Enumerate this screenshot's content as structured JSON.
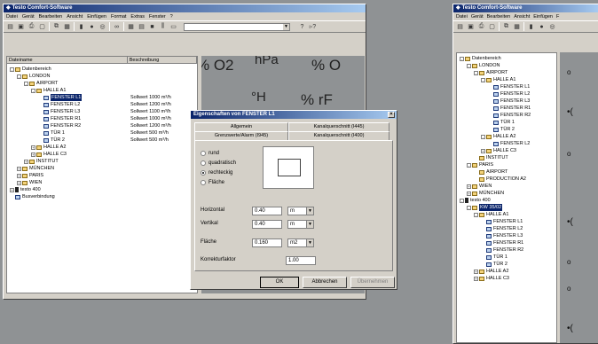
{
  "left_window": {
    "title": "Testo Comfort-Software",
    "menu": [
      "Datei",
      "Gerät",
      "Bearbeiten",
      "Ansicht",
      "Einfügen",
      "Format",
      "Extras",
      "Fenster",
      "?"
    ],
    "columns": [
      "Dateiname",
      "Beschreibung"
    ],
    "tree": [
      {
        "label": "Datenbereich",
        "level": 0,
        "icon": "folder",
        "exp": "-"
      },
      {
        "label": "LONDON",
        "level": 1,
        "icon": "folder",
        "exp": "-"
      },
      {
        "label": "AIRPORT",
        "level": 2,
        "icon": "folder",
        "exp": "-"
      },
      {
        "label": "HALLE A1",
        "level": 3,
        "icon": "folder",
        "exp": "-"
      },
      {
        "label": "FENSTER L1",
        "level": 4,
        "icon": "window",
        "desc": "Sollwert 1000 m³/h",
        "selected": true
      },
      {
        "label": "FENSTER L2",
        "level": 4,
        "icon": "window",
        "desc": "Sollwert 1200 m³/h"
      },
      {
        "label": "FENSTER L3",
        "level": 4,
        "icon": "window",
        "desc": "Sollwert 1100 m³/h"
      },
      {
        "label": "FENSTER R1",
        "level": 4,
        "icon": "window",
        "desc": "Sollwert 1000 m³/h"
      },
      {
        "label": "FENSTER R2",
        "level": 4,
        "icon": "window",
        "desc": "Sollwert 1200 m³/h"
      },
      {
        "label": "TÜR 1",
        "level": 4,
        "icon": "window",
        "desc": "Sollwert 500 m³/h"
      },
      {
        "label": "TÜR 2",
        "level": 4,
        "icon": "window",
        "desc": "Sollwert 500 m³/h"
      },
      {
        "label": "HALLE A2",
        "level": 3,
        "icon": "folder",
        "exp": "+"
      },
      {
        "label": "HALLE C3",
        "level": 3,
        "icon": "folder",
        "exp": "+"
      },
      {
        "label": "INSTITUT",
        "level": 2,
        "icon": "folder",
        "exp": "+"
      },
      {
        "label": "MÜNCHEN",
        "level": 1,
        "icon": "folder",
        "exp": "+"
      },
      {
        "label": "PARIS",
        "level": 1,
        "icon": "folder",
        "exp": "+"
      },
      {
        "label": "WIEN",
        "level": 1,
        "icon": "folder",
        "exp": "+"
      },
      {
        "label": "testo 400",
        "level": 0,
        "icon": "device",
        "exp": "+"
      },
      {
        "label": "Busverbindung",
        "level": 0,
        "icon": "bus"
      }
    ],
    "units": [
      "% O2",
      "hPa",
      "% O",
      "°H",
      "% rF"
    ]
  },
  "dialog": {
    "title": "Eigenschaften von FENSTER L1",
    "tabs_back": [
      "Allgemein",
      "Kanalquerschnitt (I445)"
    ],
    "tabs_front": [
      "Grenzwerte/Alarm (I945)",
      "Kanalquerschnitt (I400)"
    ],
    "shapes": [
      "rund",
      "quadratisch",
      "rechteckig",
      "Fläche"
    ],
    "selected_shape": "rechteckig",
    "horizontal_label": "Horizontal",
    "horizontal_value": "0.40",
    "horizontal_unit": "m",
    "vertical_label": "Vertikal",
    "vertical_value": "0.40",
    "vertical_unit": "m",
    "area_label": "Fläche",
    "area_value": "0.160",
    "area_unit": "m2",
    "factor_label": "Korrekturfaktor",
    "factor_value": "1.00",
    "ok": "OK",
    "cancel": "Abbrechen",
    "apply": "Übernehmen"
  },
  "right_window": {
    "title": "Testo Comfort-Software",
    "menu": [
      "Datei",
      "Gerät",
      "Bearbeiten",
      "Ansicht",
      "Einfügen",
      "F"
    ],
    "tree": [
      {
        "label": "Datenbereich",
        "level": 0,
        "icon": "folder",
        "exp": "-"
      },
      {
        "label": "LONDON",
        "level": 1,
        "icon": "folder",
        "exp": "-"
      },
      {
        "label": "AIRPORT",
        "level": 2,
        "icon": "folder",
        "exp": "-"
      },
      {
        "label": "HALLE A1",
        "level": 3,
        "icon": "folder",
        "exp": "-"
      },
      {
        "label": "FENSTER L1",
        "level": 4,
        "icon": "window"
      },
      {
        "label": "FENSTER L2",
        "level": 4,
        "icon": "window"
      },
      {
        "label": "FENSTER L3",
        "level": 4,
        "icon": "window"
      },
      {
        "label": "FENSTER R1",
        "level": 4,
        "icon": "window"
      },
      {
        "label": "FENSTER R2",
        "level": 4,
        "icon": "window"
      },
      {
        "label": "TÜR 1",
        "level": 4,
        "icon": "window"
      },
      {
        "label": "TÜR 2",
        "level": 4,
        "icon": "window"
      },
      {
        "label": "HALLE A2",
        "level": 3,
        "icon": "folder",
        "exp": "-"
      },
      {
        "label": "FENSTER L2",
        "level": 4,
        "icon": "window"
      },
      {
        "label": "HALLE C3",
        "level": 3,
        "icon": "folder",
        "exp": "+"
      },
      {
        "label": "INSTITUT",
        "level": 2,
        "icon": "folder"
      },
      {
        "label": "PARIS",
        "level": 1,
        "icon": "folder",
        "exp": "-"
      },
      {
        "label": "AIRPORT",
        "level": 2,
        "icon": "folder"
      },
      {
        "label": "PRODUCTION A2",
        "level": 2,
        "icon": "folder"
      },
      {
        "label": "WIEN",
        "level": 1,
        "icon": "folder",
        "exp": "+"
      },
      {
        "label": "MÜNCHEN",
        "level": 1,
        "icon": "folder",
        "exp": "+"
      },
      {
        "label": "testo 400",
        "level": 0,
        "icon": "device",
        "exp": "-"
      },
      {
        "label": "KW 35/02",
        "level": 1,
        "icon": "folder",
        "exp": "-",
        "selected": true
      },
      {
        "label": "HALLE A1",
        "level": 2,
        "icon": "folder",
        "exp": "-"
      },
      {
        "label": "FENSTER L1",
        "level": 3,
        "icon": "window"
      },
      {
        "label": "FENSTER L2",
        "level": 3,
        "icon": "window"
      },
      {
        "label": "FENSTER L3",
        "level": 3,
        "icon": "window"
      },
      {
        "label": "FENSTER R1",
        "level": 3,
        "icon": "window"
      },
      {
        "label": "FENSTER R2",
        "level": 3,
        "icon": "window"
      },
      {
        "label": "TÜR 1",
        "level": 3,
        "icon": "window"
      },
      {
        "label": "TÜR 2",
        "level": 3,
        "icon": "window"
      },
      {
        "label": "HALLE A2",
        "level": 2,
        "icon": "folder",
        "exp": "+"
      },
      {
        "label": "HALLE C3",
        "level": 2,
        "icon": "folder",
        "exp": "+"
      }
    ]
  }
}
